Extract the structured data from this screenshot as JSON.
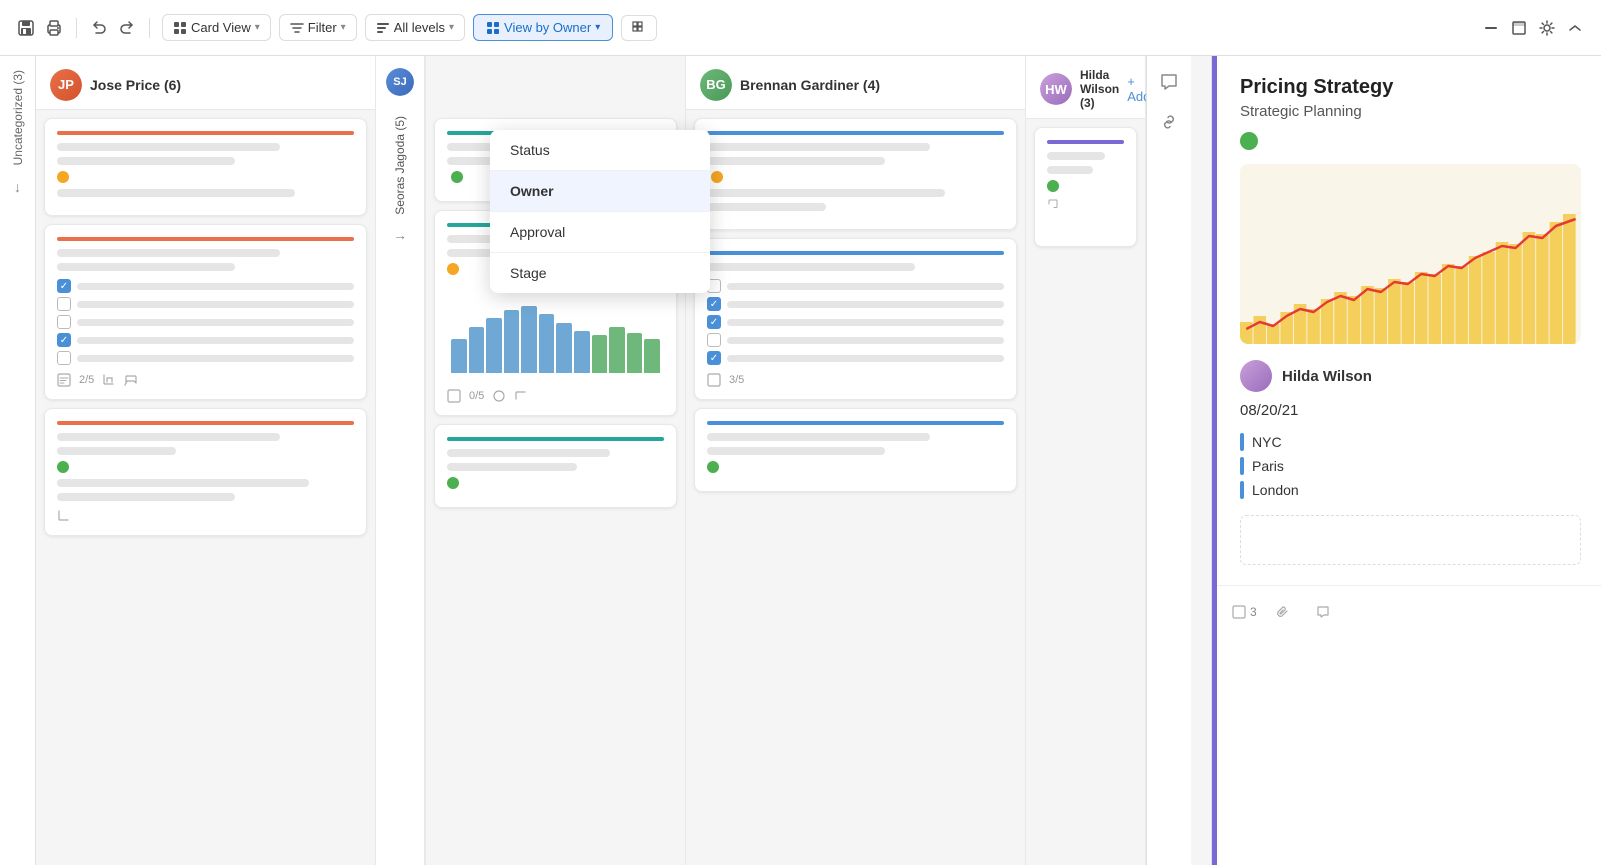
{
  "toolbar": {
    "save_icon": "💾",
    "print_icon": "🖨",
    "undo_icon": "↺",
    "redo_icon": "↻",
    "view_label": "Card View",
    "filter_label": "Filter",
    "levels_label": "All levels",
    "view_by_label": "View by Owner",
    "grid_icon": "⊞",
    "settings_icon": "⚙",
    "collapse_icon": "∧"
  },
  "columns": [
    {
      "id": "jose",
      "name": "Jose Price",
      "count": 6,
      "avatar_initials": "JP",
      "avatar_class": "av-jose"
    },
    {
      "id": "seoras",
      "name": "Seoras Jagoda",
      "count": 5,
      "avatar_initials": "SJ",
      "avatar_class": "av-seoras"
    },
    {
      "id": "brennan",
      "name": "Brennan Gardiner",
      "count": 4,
      "avatar_initials": "BG",
      "avatar_class": "av-brennan"
    },
    {
      "id": "hilda",
      "name": "Hilda Wilson",
      "count": 3,
      "avatar_initials": "HW",
      "avatar_class": "av-hilda"
    }
  ],
  "sidebar": {
    "label": "Uncategorized (3)"
  },
  "dropdown": {
    "items": [
      "Status",
      "Owner",
      "Approval",
      "Stage"
    ],
    "selected": "Owner"
  },
  "detail": {
    "title": "Pricing Strategy",
    "subtitle": "Strategic Planning",
    "status_color": "#4caf50",
    "owner_name": "Hilda Wilson",
    "date": "08/20/21",
    "locations": [
      "NYC",
      "Paris",
      "London"
    ],
    "task_count": 3,
    "chart_bars": [
      20,
      25,
      18,
      28,
      35,
      30,
      38,
      42,
      40,
      50,
      48,
      55,
      52,
      60,
      58,
      65,
      63,
      70,
      75,
      80,
      78,
      85,
      82,
      90,
      95
    ],
    "chart_line": [
      15,
      18,
      22,
      20,
      28,
      32,
      30,
      38,
      42,
      45,
      50,
      48,
      55,
      58,
      62,
      65,
      68,
      72,
      78,
      82,
      85,
      88,
      92,
      95,
      98
    ]
  },
  "uncategorized": {
    "label": "Uncategorized (3)",
    "count": 3
  }
}
